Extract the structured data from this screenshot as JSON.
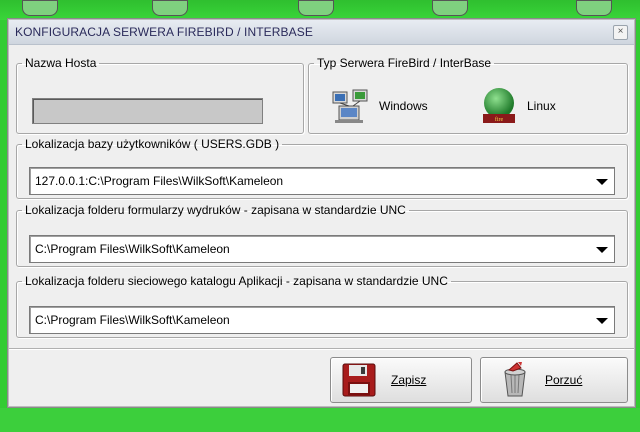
{
  "window": {
    "title": "KONFIGURACJA SERWERA FIREBIRD / INTERBASE",
    "close_glyph": "×"
  },
  "host": {
    "legend": "Nazwa Hosta",
    "value": ""
  },
  "server_type": {
    "legend": "Typ Serwera FireBird / InterBase",
    "options": [
      {
        "label": "Windows",
        "icon": "windows-server-icon"
      },
      {
        "label": "Linux",
        "icon": "linux-server-icon"
      }
    ]
  },
  "users_db": {
    "legend": "Lokalizacja bazy użytkowników  ( USERS.GDB )",
    "value": "127.0.0.1:C:\\Program Files\\WilkSoft\\Kameleon"
  },
  "print_forms": {
    "legend": "Lokalizacja folderu formularzy wydruków - zapisana  w standardzie  UNC",
    "value": "C:\\Program Files\\WilkSoft\\Kameleon"
  },
  "app_catalog": {
    "legend": "Lokalizacja folderu sieciowego katalogu Aplikacji - zapisana  w standardzie  UNC",
    "value": "C:\\Program Files\\WilkSoft\\Kameleon"
  },
  "buttons": {
    "save": {
      "label": "Zapisz",
      "icon": "floppy-disk-icon"
    },
    "cancel": {
      "label": "Porzuć",
      "icon": "trash-bin-icon"
    }
  }
}
